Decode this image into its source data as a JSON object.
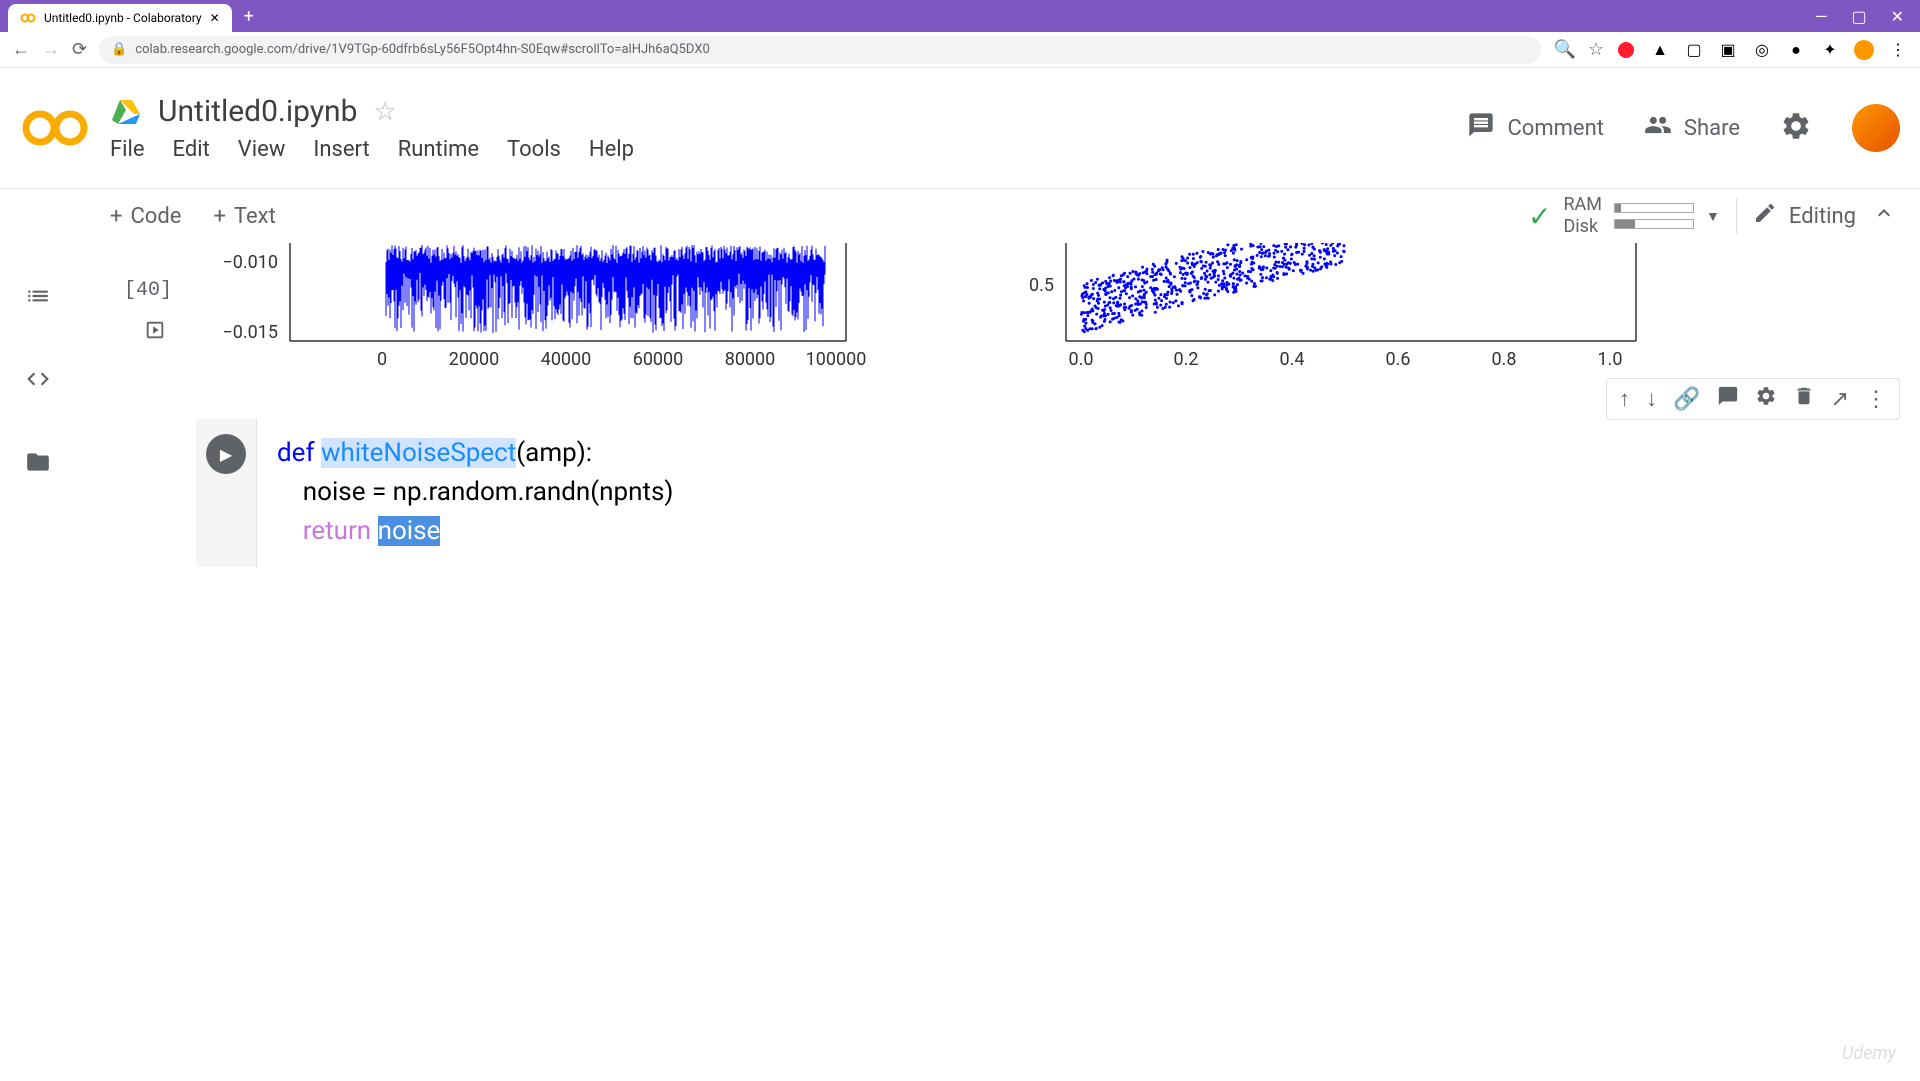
{
  "browser": {
    "tab_title": "Untitled0.ipynb - Colaboratory",
    "url": "colab.research.google.com/drive/1V9TGp-60dfrb6sLy56F5Opt4hn-S0Eqw#scrollTo=alHJh6aQ5DX0"
  },
  "header": {
    "title": "Untitled0.ipynb",
    "menu": [
      "File",
      "Edit",
      "View",
      "Insert",
      "Runtime",
      "Tools",
      "Help"
    ],
    "comment": "Comment",
    "share": "Share"
  },
  "actionbar": {
    "code": "Code",
    "text": "Text",
    "ram": "RAM",
    "disk": "Disk",
    "editing": "Editing"
  },
  "cell_output": {
    "label": "[40]"
  },
  "chart_data": [
    {
      "type": "line",
      "xlabel": "",
      "ylabel": "",
      "xlim": [
        0,
        100000
      ],
      "ylim": [
        -0.015,
        -0.005
      ],
      "xticks": [
        0,
        20000,
        40000,
        60000,
        80000,
        100000
      ],
      "yticks": [
        -0.015,
        -0.01
      ],
      "note": "dense noisy blue signal across x-range, values mostly between -0.010 and -0.006"
    },
    {
      "type": "scatter",
      "xlabel": "",
      "ylabel": "",
      "xlim": [
        0.0,
        1.2
      ],
      "ylim": [
        0.4,
        1.0
      ],
      "xticks": [
        0.0,
        0.2,
        0.4,
        0.6,
        0.8,
        1.0
      ],
      "yticks": [
        0.5
      ],
      "note": "dense blue scatter points concentrated 0.0-0.5 on x, rising from ~0.45 to ~1.0"
    }
  ],
  "code": {
    "line1_def": "def ",
    "line1_fn": "whiteNoiseSpect",
    "line1_rest": "(amp):",
    "line2": "    noise = np.random.randn(npnts)",
    "line3_indent": "    ",
    "line3_return": "return",
    "line3_space": " ",
    "line3_noise": "noise"
  },
  "watermark": "Udemy"
}
